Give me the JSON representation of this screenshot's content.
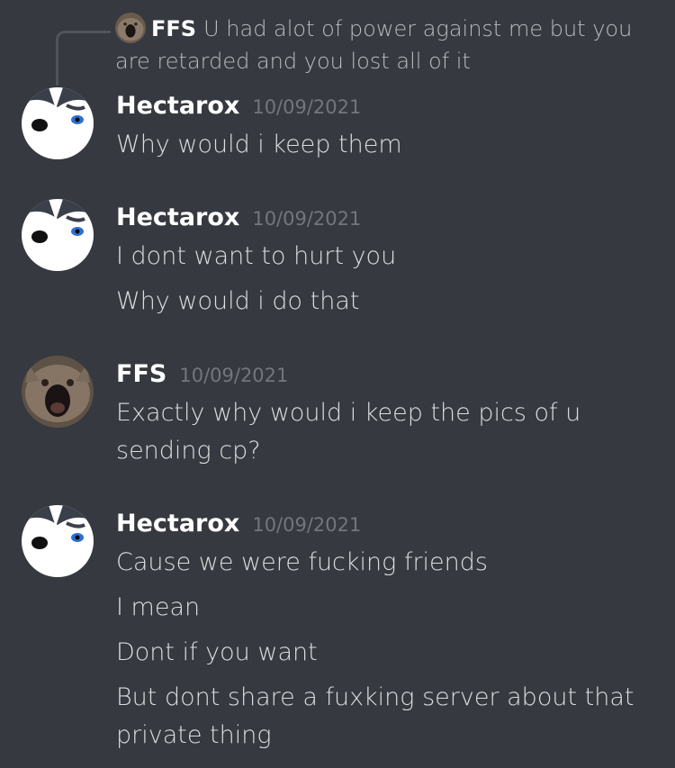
{
  "reply": {
    "author": "FFS",
    "text": "U had alot of power against me but you are retarded and you lost all of it"
  },
  "messages": [
    {
      "author": "Hectarox",
      "timestamp": "10/09/2021",
      "avatar_icon": "husky-avatar-icon",
      "lines": [
        "Why would i keep them"
      ]
    },
    {
      "author": "Hectarox",
      "timestamp": "10/09/2021",
      "avatar_icon": "husky-avatar-icon",
      "lines": [
        "I dont want to hurt you",
        "Why would i do that"
      ]
    },
    {
      "author": "FFS",
      "timestamp": "10/09/2021",
      "avatar_icon": "screaming-cat-avatar-icon",
      "lines": [
        "Exactly why would i keep the pics of u sending cp?"
      ]
    },
    {
      "author": "Hectarox",
      "timestamp": "10/09/2021",
      "avatar_icon": "husky-avatar-icon",
      "lines": [
        "Cause we were fucking friends",
        "I mean",
        "Dont if you want",
        "But dont share a fuxking server about that private thing"
      ]
    }
  ],
  "colors": {
    "background": "#36393f",
    "username": "#ffffff",
    "text": "#dcddde",
    "timestamp": "#72767d",
    "reply_spine": "#4f545c"
  }
}
